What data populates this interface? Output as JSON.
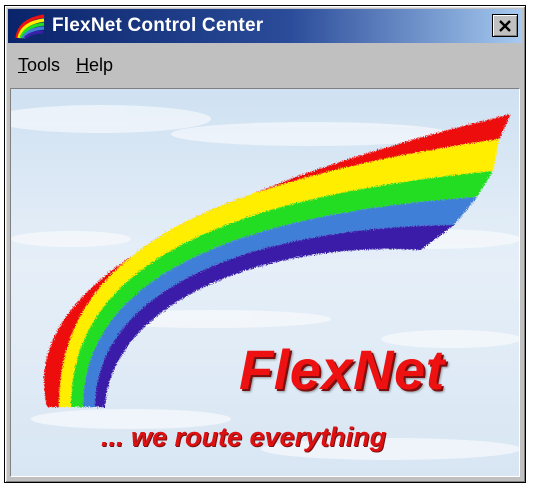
{
  "window": {
    "title": "FlexNet Control Center",
    "close_label": "×"
  },
  "menu": {
    "tools": {
      "mnemonic": "T",
      "rest": "ools"
    },
    "help": {
      "mnemonic": "H",
      "rest": "elp"
    }
  },
  "splash": {
    "brand": "FlexNet",
    "tagline": "... we route everything"
  },
  "colors": {
    "titlebar_start": "#0a246a",
    "titlebar_end": "#a6caf0",
    "window_face": "#c0c0c0",
    "brand_red": "#ee1111",
    "rainbow": [
      "#ee1111",
      "#ffee00",
      "#22dd22",
      "#3f7fd8",
      "#3a1fa8"
    ]
  },
  "icons": {
    "title": "rainbow-icon",
    "close": "close-icon"
  }
}
